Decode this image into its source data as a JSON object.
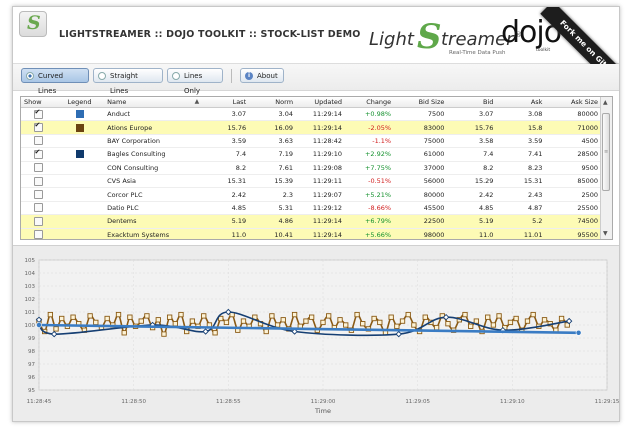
{
  "header": {
    "logo_letter": "S",
    "title": "LIGHTSTREAMER :: DOJO TOOLKIT :: STOCK-LIST DEMO",
    "brand_light": "Light",
    "brand_s": "S",
    "brand_treamer": "treamer",
    "brand_reg": "®",
    "brand_tagline": "Real-Time Data Push",
    "dojo": "dojo",
    "dojo_sub": "toolkit",
    "ribbon": "Fork me on GitHub"
  },
  "toolbar": {
    "curved": "Curved Lines",
    "straight": "Straight Lines",
    "lines_only": "Lines Only",
    "about": "About",
    "selected": "Curved Lines"
  },
  "grid": {
    "headers": [
      "Show",
      "Legend",
      "Name",
      "Last",
      "Norm",
      "Updated",
      "Change",
      "Bid Size",
      "Bid",
      "Ask",
      "Ask Size"
    ],
    "sort_indicator": "▲",
    "rows": [
      {
        "show": true,
        "legend": "#2e6db3",
        "name": "Anduct",
        "last": "3.07",
        "norm": "3.04",
        "updated": "11:29:14",
        "change": "+0.98%",
        "bid_size": "7500",
        "bid": "3.07",
        "ask": "3.08",
        "ask_size": "80000",
        "hl": false
      },
      {
        "show": true,
        "legend": "#6b4310",
        "name": "Ations Europe",
        "last": "15.76",
        "norm": "16.09",
        "updated": "11:29:14",
        "change": "-2.05%",
        "bid_size": "83000",
        "bid": "15.76",
        "ask": "15.8",
        "ask_size": "71000",
        "hl": true
      },
      {
        "show": false,
        "legend": "",
        "name": "BAY Corporation",
        "last": "3.59",
        "norm": "3.63",
        "updated": "11:28:42",
        "change": "-1.1%",
        "bid_size": "75000",
        "bid": "3.58",
        "ask": "3.59",
        "ask_size": "4500",
        "hl": false
      },
      {
        "show": true,
        "legend": "#0f3a6c",
        "name": "Bagles Consulting",
        "last": "7.4",
        "norm": "7.19",
        "updated": "11:29:10",
        "change": "+2.92%",
        "bid_size": "61000",
        "bid": "7.4",
        "ask": "7.41",
        "ask_size": "28500",
        "hl": false
      },
      {
        "show": false,
        "legend": "",
        "name": "CON Consulting",
        "last": "8.2",
        "norm": "7.61",
        "updated": "11:29:08",
        "change": "+7.75%",
        "bid_size": "37000",
        "bid": "8.2",
        "ask": "8.23",
        "ask_size": "9500",
        "hl": false
      },
      {
        "show": false,
        "legend": "",
        "name": "CVS Asia",
        "last": "15.31",
        "norm": "15.39",
        "updated": "11:29:11",
        "change": "-0.51%",
        "bid_size": "56000",
        "bid": "15.29",
        "ask": "15.31",
        "ask_size": "85000",
        "hl": false
      },
      {
        "show": false,
        "legend": "",
        "name": "Corcor PLC",
        "last": "2.42",
        "norm": "2.3",
        "updated": "11:29:07",
        "change": "+5.21%",
        "bid_size": "80000",
        "bid": "2.42",
        "ask": "2.43",
        "ask_size": "2500",
        "hl": false
      },
      {
        "show": false,
        "legend": "",
        "name": "Datio PLC",
        "last": "4.85",
        "norm": "5.31",
        "updated": "11:29:12",
        "change": "-8.66%",
        "bid_size": "45500",
        "bid": "4.85",
        "ask": "4.87",
        "ask_size": "25500",
        "hl": false
      },
      {
        "show": false,
        "legend": "",
        "name": "Dentems",
        "last": "5.19",
        "norm": "4.86",
        "updated": "11:29:14",
        "change": "+6.79%",
        "bid_size": "22500",
        "bid": "5.19",
        "ask": "5.2",
        "ask_size": "74500",
        "hl": true
      },
      {
        "show": false,
        "legend": "",
        "name": "Exacktum Systems",
        "last": "11.0",
        "norm": "10.41",
        "updated": "11:29:14",
        "change": "+5.66%",
        "bid_size": "98000",
        "bid": "11.0",
        "ask": "11.01",
        "ask_size": "95500",
        "hl": true
      }
    ]
  },
  "chart_data": {
    "type": "line",
    "xlabel": "Time",
    "ylabel": "",
    "ylim": [
      95,
      105
    ],
    "yticks": [
      "95",
      "96",
      "97",
      "98",
      "99",
      "100",
      "101",
      "102",
      "103",
      "104",
      "105"
    ],
    "xticks": [
      "11:28:45",
      "11:28:50",
      "11:28:55",
      "11:29:00",
      "11:29:05",
      "11:29:10",
      "11:29:15"
    ],
    "xlim_seconds_after_first_tick": [
      0,
      30
    ],
    "grid": true,
    "series": [
      {
        "color": "#8a5a14",
        "marker": "square",
        "x": [
          0,
          0.3,
          0.6,
          0.9,
          1.2,
          1.5,
          1.8,
          2.1,
          2.4,
          2.7,
          3.0,
          3.3,
          3.6,
          3.9,
          4.2,
          4.5,
          4.8,
          5.1,
          5.4,
          5.7,
          6.0,
          6.3,
          6.6,
          6.9,
          7.2,
          7.5,
          7.8,
          8.1,
          8.4,
          8.7,
          9.0,
          9.3,
          9.6,
          9.9,
          10.2,
          10.5,
          10.8,
          11.1,
          11.4,
          11.7,
          12.0,
          12.3,
          12.6,
          12.9,
          13.2,
          13.5,
          13.8,
          14.1,
          14.4,
          14.7,
          15.0,
          15.3,
          15.6,
          15.9,
          16.2,
          16.5,
          16.8,
          17.1,
          17.4,
          17.7,
          18.0,
          18.3,
          18.6,
          18.9,
          19.2,
          19.5,
          19.8,
          20.1,
          20.4,
          20.7,
          21.0,
          21.3,
          21.6,
          21.9,
          22.2,
          22.5,
          22.8,
          23.1,
          23.4,
          23.7,
          24.0,
          24.3,
          24.6,
          24.9,
          25.2,
          25.5,
          25.8,
          26.1,
          26.4,
          26.7,
          27.0,
          27.3,
          27.6,
          27.9
        ],
        "y": [
          100.3,
          99.5,
          100.8,
          99.7,
          100.5,
          99.9,
          100.6,
          100.1,
          99.6,
          100.7,
          100.2,
          99.8,
          100.5,
          100.0,
          100.8,
          99.4,
          100.6,
          99.9,
          100.3,
          100.7,
          99.8,
          100.4,
          99.3,
          100.6,
          100.1,
          100.8,
          99.5,
          100.3,
          99.9,
          100.7,
          100.0,
          99.4,
          100.5,
          100.2,
          100.8,
          99.6,
          100.3,
          99.9,
          100.6,
          100.1,
          99.5,
          100.7,
          100.0,
          100.4,
          99.7,
          100.8,
          99.9,
          100.3,
          100.6,
          99.6,
          100.2,
          100.7,
          99.8,
          100.4,
          100.0,
          99.6,
          100.8,
          100.1,
          99.7,
          100.5,
          100.2,
          99.4,
          100.6,
          99.9,
          100.3,
          100.8,
          100.0,
          99.5,
          100.6,
          100.2,
          99.8,
          100.7,
          100.1,
          99.6,
          100.4,
          100.8,
          99.9,
          100.3,
          99.5,
          100.6,
          100.0,
          100.7,
          99.8,
          100.2,
          100.5,
          99.6,
          100.3,
          100.8,
          99.9,
          100.4,
          100.1,
          99.6,
          100.5,
          100.0
        ]
      },
      {
        "color": "#163f73",
        "marker": "diamond",
        "x": [
          0,
          0.8,
          6.0,
          8.8,
          10.0,
          13.5,
          19.0,
          21.5,
          24.5,
          28.0
        ],
        "y": [
          100.4,
          99.3,
          100.0,
          99.5,
          101.0,
          99.5,
          99.3,
          100.6,
          99.6,
          100.3
        ]
      },
      {
        "color": "#3a7cc4",
        "marker": "circle",
        "x": [
          0,
          28.5
        ],
        "y": [
          100.0,
          99.4
        ]
      }
    ]
  }
}
